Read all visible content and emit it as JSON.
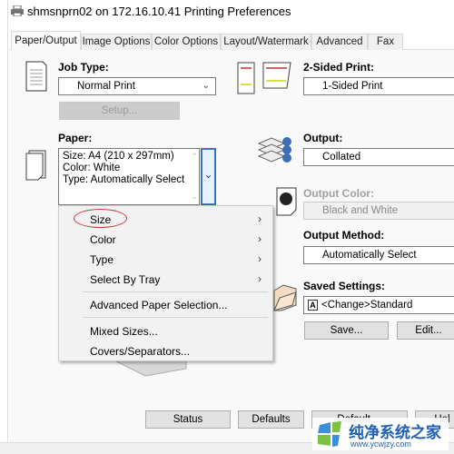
{
  "window": {
    "title": "shmsnprn02 on 172.16.10.41 Printing Preferences",
    "icon": "printer-icon"
  },
  "tabs": [
    {
      "label": "Paper/Output",
      "selected": true
    },
    {
      "label": "Image Options"
    },
    {
      "label": "Color Options"
    },
    {
      "label": "Layout/Watermark"
    },
    {
      "label": "Advanced"
    },
    {
      "label": "Fax"
    }
  ],
  "job_type": {
    "label": "Job Type:",
    "value": "Normal Print",
    "setup_label": "Setup..."
  },
  "two_sided": {
    "label": "2-Sided Print:",
    "value": "1-Sided Print"
  },
  "paper": {
    "label": "Paper:",
    "lines": [
      "Size: A4 (210 x 297mm)",
      "Color: White",
      "Type: Automatically Select"
    ]
  },
  "paper_menu": {
    "items": [
      "Size",
      "Color",
      "Type",
      "Select By Tray",
      "Advanced Paper Selection...",
      "Mixed Sizes...",
      "Covers/Separators..."
    ],
    "highlighted": "Size",
    "highlight_color": "#d0343c"
  },
  "output": {
    "label": "Output:",
    "value": "Collated"
  },
  "output_color": {
    "label": "Output Color:",
    "value": "Black and White",
    "disabled": true
  },
  "output_method": {
    "label": "Output Method:",
    "value": "Automatically Select"
  },
  "saved_settings": {
    "label": "Saved Settings:",
    "value": "<Change>Standard",
    "badge": "A",
    "save_label": "Save...",
    "edit_label": "Edit..."
  },
  "footer": {
    "status_label": "Status",
    "defaults_label": "Defaults",
    "default3_label": "Default ...",
    "help_label": "Hel"
  },
  "watermark": {
    "text": "纯净系统之家",
    "url": "www.ycwjzy.com"
  }
}
